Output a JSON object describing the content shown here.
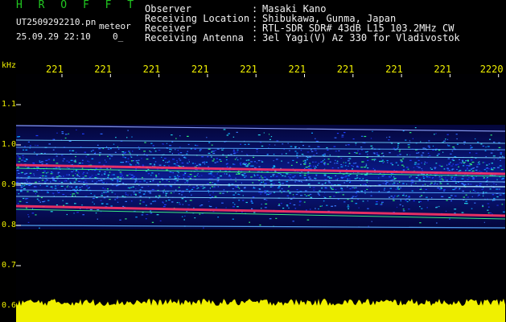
{
  "header": {
    "app_name": "H R O F F T",
    "filename": "UT2509292210.pn",
    "meteor_label": "meteor",
    "datetime": "25.09.29 22:10",
    "counter": "0_"
  },
  "info": [
    {
      "label": "Observer",
      "value": "Masaki Kano"
    },
    {
      "label": "Receiving Location",
      "value": "Shibukawa, Gunma, Japan"
    },
    {
      "label": "Receiver",
      "value": "RTL-SDR SDR# 43dB L15 103.2MHz CW"
    },
    {
      "label": "Receiving Antenna",
      "value": "3el Yagi(V) Az 330 for Vladivostok"
    }
  ],
  "y_axis": {
    "unit": "kHz",
    "ticks": [
      "1.1",
      "1.0",
      "0.9",
      "0.8",
      "0.7",
      "0.6"
    ]
  },
  "x_axis": {
    "ticks": [
      "221",
      "221",
      "221",
      "221",
      "221",
      "221",
      "221",
      "221",
      "221",
      "2220"
    ]
  },
  "colors": {
    "background": "#000000",
    "title_green": "#21c821",
    "tick_yellow": "#f0f000",
    "signal_red": "#ff3366"
  }
}
